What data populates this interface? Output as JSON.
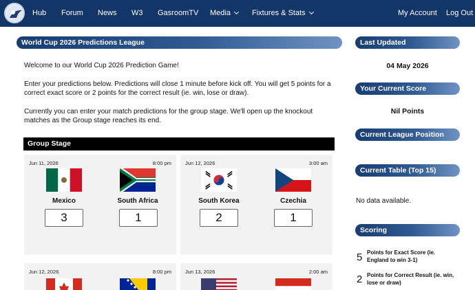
{
  "nav": {
    "items": [
      "Hub",
      "Forum",
      "News",
      "W3",
      "GasroomTV",
      "Media",
      "Fixtures & Stats"
    ],
    "right": [
      "My Account",
      "Log Out"
    ]
  },
  "main": {
    "title": "World Cup 2026 Predictions League",
    "intro": "Welcome to our World Cup 2026 Prediction Game!",
    "rules_line1": "Enter your predictions below. Predictions will close 1 minute before kick off. You will get 5 points for a",
    "rules_line2": "correct exact score or 2 points for the correct result (ie. win, lose or draw).",
    "current_line1": "Currently you can enter your match predictions for the group stage. We'll open up the knockout",
    "current_line2": "matches as the Group stage reaches its end.",
    "group_stage_title": "Group Stage",
    "matches": [
      {
        "date": "Jun 11, 2026",
        "time": "8:00 pm",
        "home": "Mexico",
        "away": "South Africa",
        "home_score": "3",
        "away_score": "1"
      },
      {
        "date": "Jun 12, 2026",
        "time": "3:00 am",
        "home": "South Korea",
        "away": "Czechia",
        "home_score": "2",
        "away_score": "1"
      },
      {
        "date": "Jun 12, 2026",
        "time": "8:00 pm",
        "home": "",
        "away": "",
        "home_score": "",
        "away_score": ""
      },
      {
        "date": "Jun 13, 2026",
        "time": "2:00 am",
        "home": "",
        "away": "",
        "home_score": "",
        "away_score": ""
      }
    ]
  },
  "sidebar": {
    "last_updated_title": "Last Updated",
    "last_updated_value": "04 May 2026",
    "score_title": "Your Current Score",
    "score_value": "Nil Points",
    "position_title": "Current League Position",
    "table_title": "Current Table (Top 15)",
    "table_empty": "No data available.",
    "scoring_title": "Scoring",
    "scoring": [
      {
        "points": "5",
        "text_l1": "Points for Exact Score (ie.",
        "text_l2": "England to win 3-1)"
      },
      {
        "points": "2",
        "text_l1": "Points for Correct Result (ie. win,",
        "text_l2": "lose or draw)"
      }
    ]
  },
  "colors": {
    "nav": "#123668",
    "bar_start": "#173d72",
    "bar_end": "#6f93c2"
  }
}
